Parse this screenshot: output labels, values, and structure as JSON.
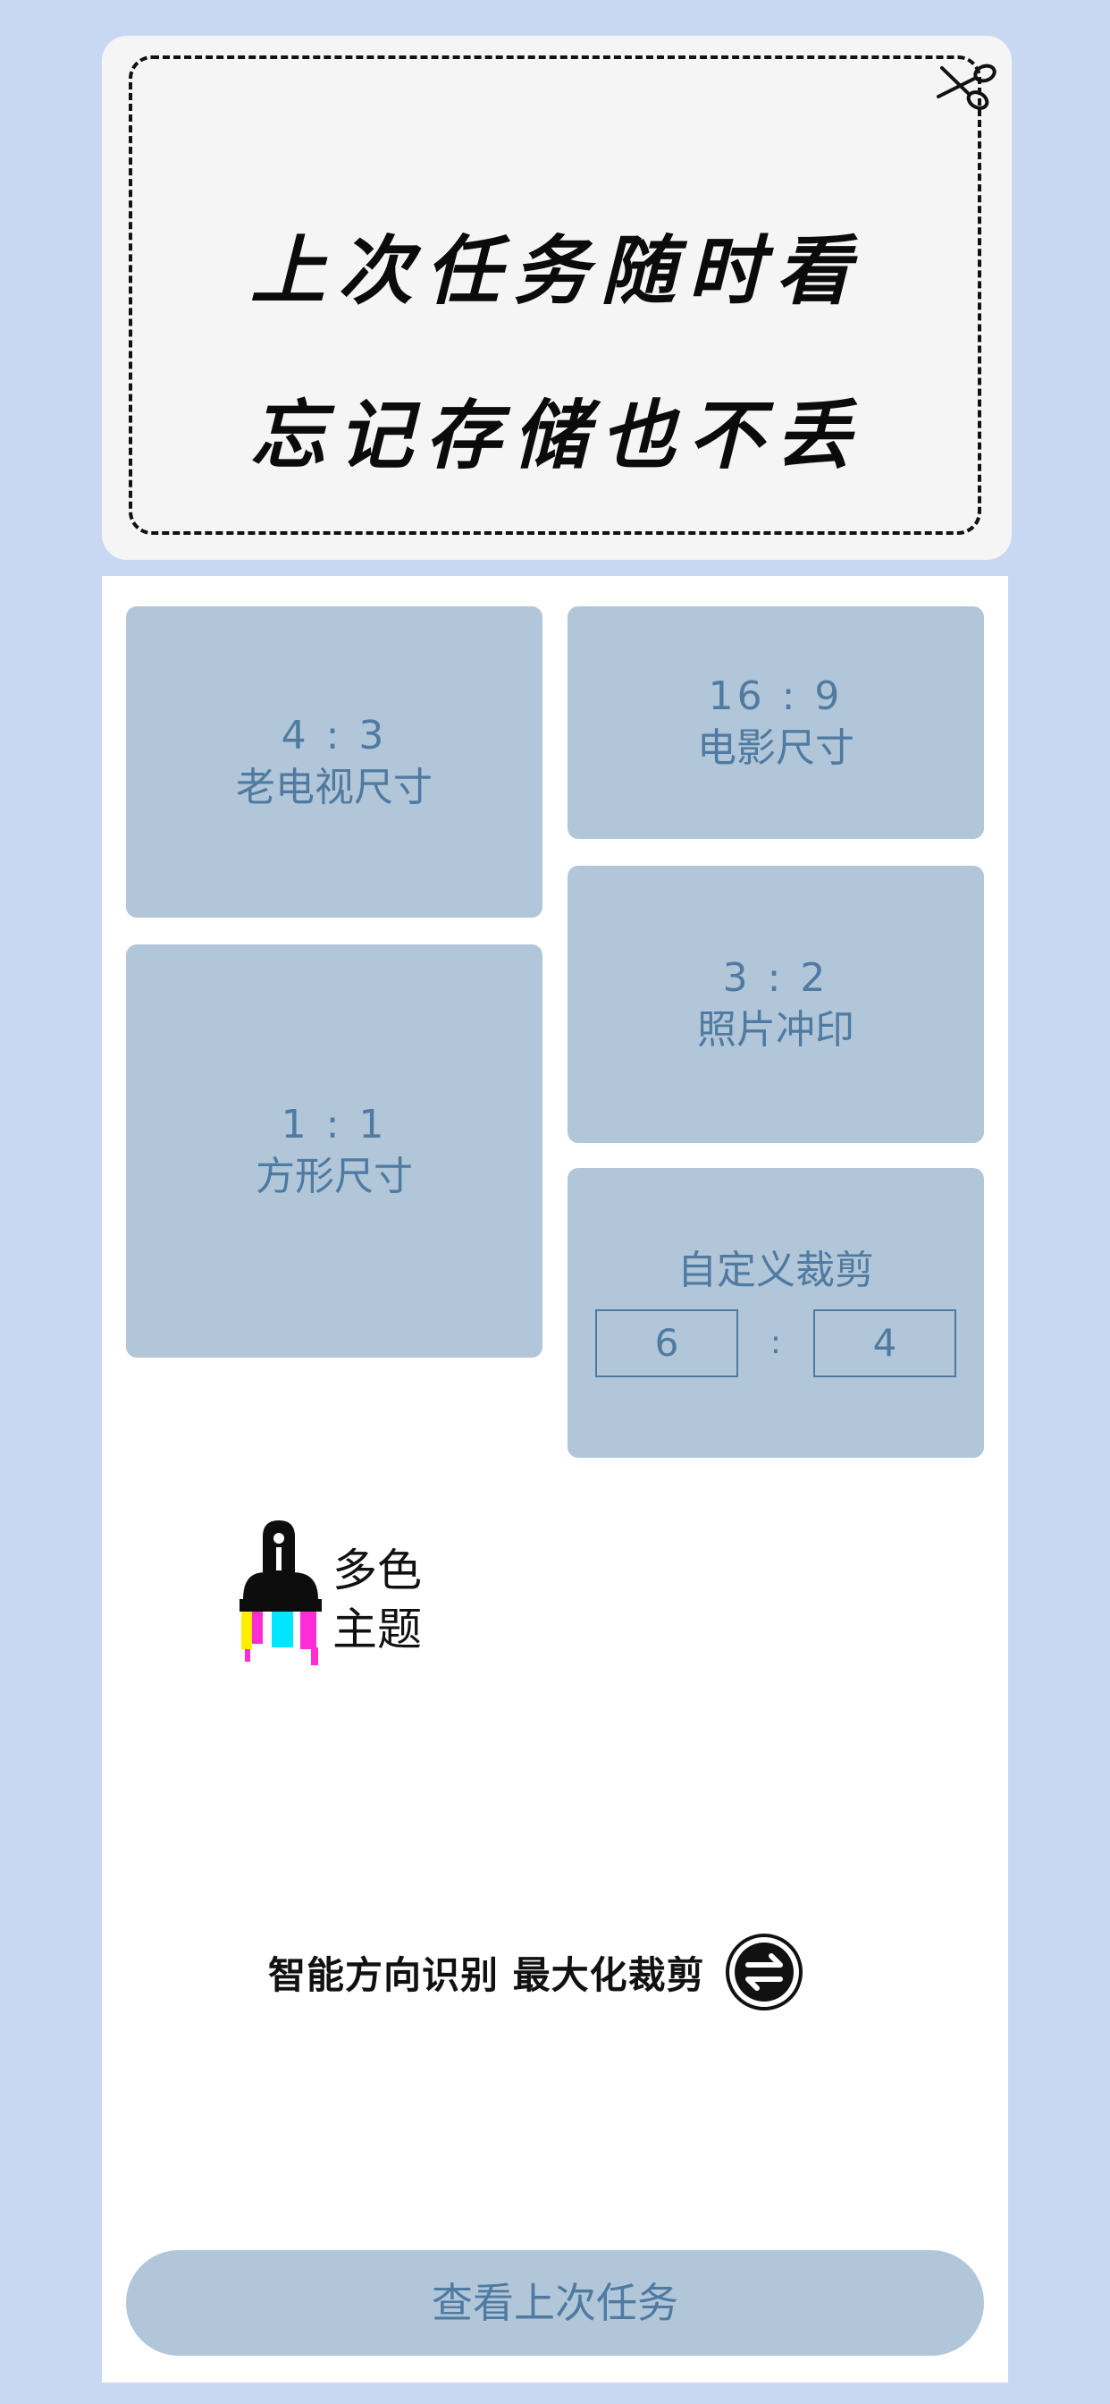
{
  "banner": {
    "line1": "上次任务随时看",
    "line2": "忘记存储也不丢",
    "icon": "scissors-icon"
  },
  "tiles": {
    "tv": {
      "ratio": "4 : 3",
      "label": "老电视尺寸"
    },
    "movie": {
      "ratio": "16 : 9",
      "label": "电影尺寸"
    },
    "square": {
      "ratio": "1 : 1",
      "label": "方形尺寸"
    },
    "photo": {
      "ratio": "3 : 2",
      "label": "照片冲印"
    },
    "custom": {
      "label": "自定义裁剪",
      "width_value": "6",
      "separator": ":",
      "height_value": "4"
    }
  },
  "theme": {
    "line1": "多色",
    "line2": "主题",
    "icon": "paint-brush-icon"
  },
  "smart_crop": {
    "label": "智能方向识别 最大化裁剪",
    "icon": "swap-icon"
  },
  "history_button": {
    "label": "查看上次任务"
  },
  "colors": {
    "background": "#c8d8f2",
    "tile": "#b1c6d8",
    "tile_text": "#4f7aa1",
    "banner": "#f5f5f5"
  }
}
